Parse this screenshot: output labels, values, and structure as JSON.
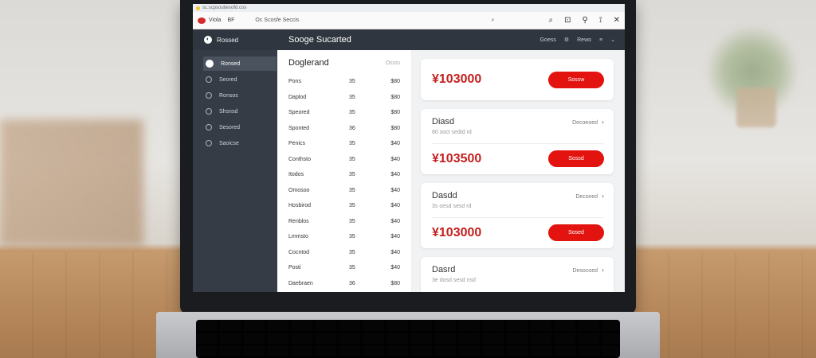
{
  "browser": {
    "tab_title": "sc.scpsoutiesofd.cos",
    "tab_name": "Viola",
    "tab_sub": "BF",
    "address": "Oc Scosfe Seccis",
    "toolbar_icons": [
      "search-icon",
      "grid-icon",
      "pin-icon",
      "share-icon",
      "close-icon"
    ]
  },
  "app": {
    "brand_label": "Rossed",
    "title": "Sooge Sucarted",
    "header_right": [
      "Goess",
      "Rewo"
    ]
  },
  "sidebar": {
    "items": [
      {
        "label": "Ronsed"
      },
      {
        "label": "Seored"
      },
      {
        "label": "Ronsos"
      },
      {
        "label": "Shsnsd"
      },
      {
        "label": "Sesored"
      },
      {
        "label": "Saoicse"
      }
    ]
  },
  "list": {
    "title": "Doglerand",
    "title_meta": "Ossto",
    "rows": [
      {
        "name": "Pons",
        "qty": "35",
        "price": "$80"
      },
      {
        "name": "Daplod",
        "qty": "35",
        "price": "$80"
      },
      {
        "name": "Speored",
        "qty": "35",
        "price": "$80"
      },
      {
        "name": "Sponted",
        "qty": "36",
        "price": "$80"
      },
      {
        "name": "Penics",
        "qty": "35",
        "price": "$40"
      },
      {
        "name": "Conthsto",
        "qty": "35",
        "price": "$40"
      },
      {
        "name": "Itodos",
        "qty": "35",
        "price": "$40"
      },
      {
        "name": "Omosoo",
        "qty": "35",
        "price": "$40"
      },
      {
        "name": "Hosbirod",
        "qty": "35",
        "price": "$40"
      },
      {
        "name": "Renblos",
        "qty": "35",
        "price": "$40"
      },
      {
        "name": "Lmmsto",
        "qty": "35",
        "price": "$40"
      },
      {
        "name": "Cocntod",
        "qty": "35",
        "price": "$40"
      },
      {
        "name": "Posti",
        "qty": "35",
        "price": "$40"
      },
      {
        "name": "Daebraen",
        "qty": "36",
        "price": "$80"
      }
    ]
  },
  "cards": [
    {
      "price": "¥103000",
      "button": "Sossw"
    },
    {
      "title": "Diasd",
      "subtitle": "80 soct sedtd rd",
      "link": "Decoeoed",
      "price": "¥103500",
      "button": "Sossd"
    },
    {
      "title": "Dasdd",
      "subtitle": "3s oesd sesd rd",
      "link": "Decseed",
      "price": "¥103000",
      "button": "Sosed"
    },
    {
      "title": "Dasrd",
      "subtitle": "3e dosd sesd nsd",
      "link": "Desocoed"
    }
  ],
  "colors": {
    "accent": "#e3130f",
    "price": "#c41f1f",
    "header_bg": "#2f363f",
    "sidebar_bg": "#353c46"
  }
}
